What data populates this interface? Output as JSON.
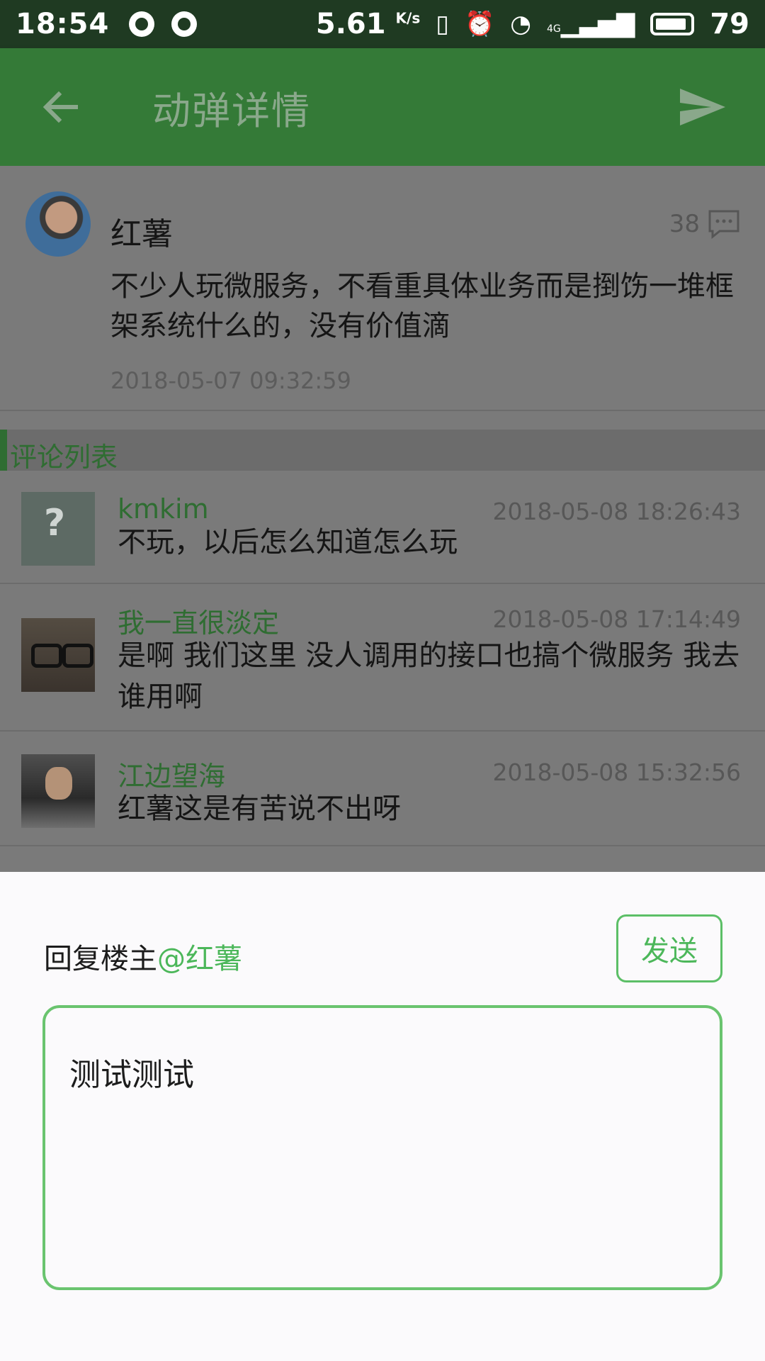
{
  "status_bar": {
    "time": "18:54",
    "speed": "5.61",
    "speed_unit": "K/s",
    "network": "4G",
    "battery": "79"
  },
  "toolbar": {
    "title": "动弹详情",
    "back_icon": "arrow-left-icon",
    "send_icon": "send-icon"
  },
  "post": {
    "author": "红薯",
    "comment_count": "38",
    "text": "不少人玩微服务，不看重具体业务而是捯饬一堆框架系统什么的，没有价值滴",
    "time": "2018-05-07 09:32:59"
  },
  "comments_section": {
    "title": "评论列表",
    "items": [
      {
        "name": "kmkim",
        "time": "2018-05-08 18:26:43",
        "text": "不玩，以后怎么知道怎么玩"
      },
      {
        "name": "我一直很淡定",
        "time": "2018-05-08 17:14:49",
        "text": "是啊 我们这里 没人调用的接口也搞个微服务 我去谁用啊"
      },
      {
        "name": "江边望海",
        "time": "2018-05-08 15:32:56",
        "text": "红薯这是有苦说不出呀"
      }
    ]
  },
  "reply_sheet": {
    "label_prefix": "回复楼主",
    "target": "@红薯",
    "send_label": "发送",
    "input_value": "测试测试"
  },
  "colors": {
    "toolbar_green": "#347a37",
    "accent_green": "#4cb75a",
    "overlay_gray": "#7a7a7a"
  }
}
